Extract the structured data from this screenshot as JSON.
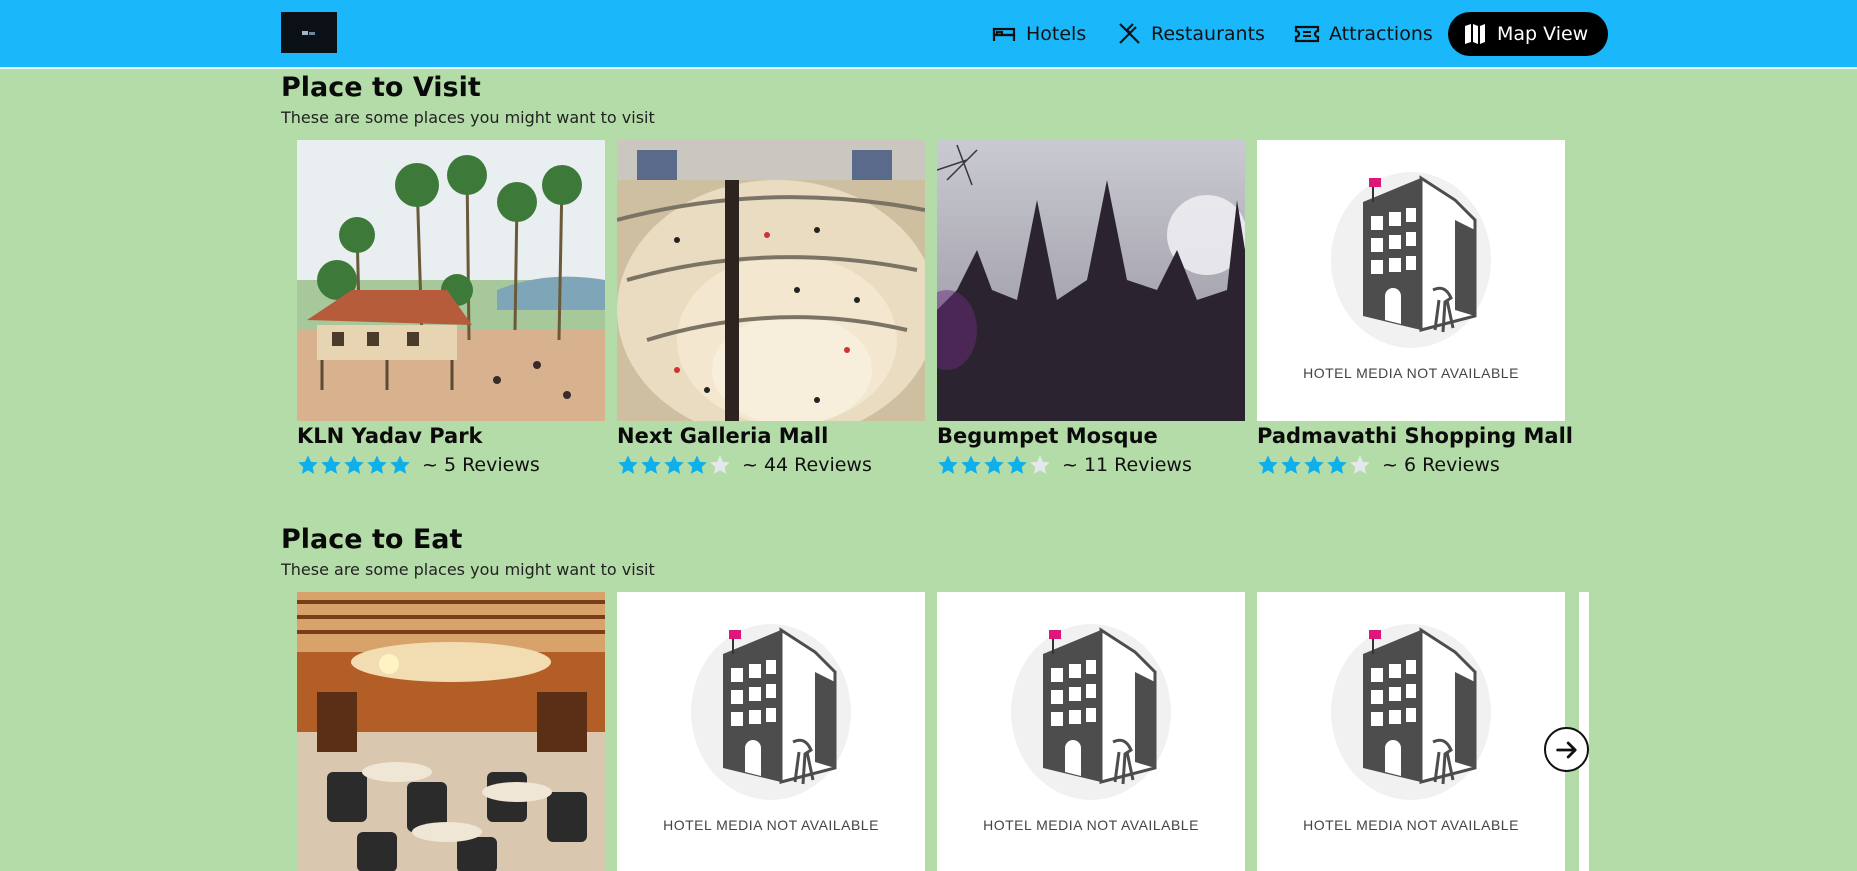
{
  "header": {
    "logo_icon": "app-logo",
    "nav": [
      {
        "label": "Hotels",
        "icon": "bed-icon"
      },
      {
        "label": "Restaurants",
        "icon": "utensils-icon"
      },
      {
        "label": "Attractions",
        "icon": "ticket-icon"
      },
      {
        "label": "Map View",
        "icon": "map-icon"
      }
    ],
    "brand_color": "#1ab8fb"
  },
  "visit": {
    "title": "Place to Visit",
    "subtitle": "These are some places you might want to visit",
    "cards": [
      {
        "name": "KLN Yadav Park",
        "rating": 5,
        "reviews": "~ 5 Reviews",
        "image": "village-painting"
      },
      {
        "name": "Next Galleria Mall",
        "rating": 4,
        "reviews": "~ 44 Reviews",
        "image": "mall-interior"
      },
      {
        "name": "Begumpet Mosque",
        "rating": 4,
        "reviews": "~ 11 Reviews",
        "image": "mosque-silhouette"
      },
      {
        "name": "Padmavathi Shopping Mall",
        "rating": 4,
        "reviews": "~ 6 Reviews",
        "image": "placeholder",
        "placeholder_text": "HOTEL MEDIA NOT AVAILABLE"
      }
    ]
  },
  "eat": {
    "title": "Place to Eat",
    "subtitle": "These are some places you might want to visit",
    "cards": [
      {
        "image": "restaurant-interior"
      },
      {
        "image": "placeholder",
        "placeholder_text": "HOTEL MEDIA NOT AVAILABLE"
      },
      {
        "image": "placeholder",
        "placeholder_text": "HOTEL MEDIA NOT AVAILABLE"
      },
      {
        "image": "placeholder",
        "placeholder_text": "HOTEL MEDIA NOT AVAILABLE"
      }
    ]
  },
  "star_color": "#0fb0ea",
  "next_icon": "arrow-right-circle-icon"
}
